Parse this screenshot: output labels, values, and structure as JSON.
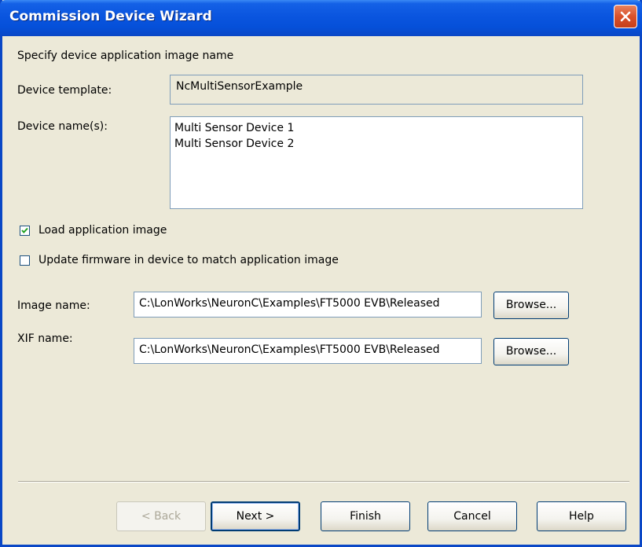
{
  "window": {
    "title": "Commission Device Wizard",
    "close_icon": "close-icon"
  },
  "form": {
    "heading": "Specify device application image name",
    "device_template_label": "Device template:",
    "device_template_value": "NcMultiSensorExample",
    "device_names_label": "Device name(s):",
    "device_names": [
      "Multi Sensor Device 1",
      "Multi Sensor Device 2"
    ],
    "load_image": {
      "label": "Load application image",
      "checked": true
    },
    "update_firmware": {
      "label": "Update firmware in device to match application image",
      "checked": false
    },
    "image_name_label": "Image name:",
    "image_name_value": "C:\\LonWorks\\NeuronC\\Examples\\FT5000 EVB\\Released",
    "xif_name_label": "XIF name:",
    "xif_name_value": "C:\\LonWorks\\NeuronC\\Examples\\FT5000 EVB\\Released",
    "browse_label": "Browse..."
  },
  "footer": {
    "back_label": "< Back",
    "next_label": "Next >",
    "finish_label": "Finish",
    "cancel_label": "Cancel",
    "help_label": "Help"
  },
  "colors": {
    "titlebar": "#0a55df",
    "dialog_bg": "#ece9d8",
    "close_button": "#d9512b",
    "field_border": "#7f9db9"
  }
}
